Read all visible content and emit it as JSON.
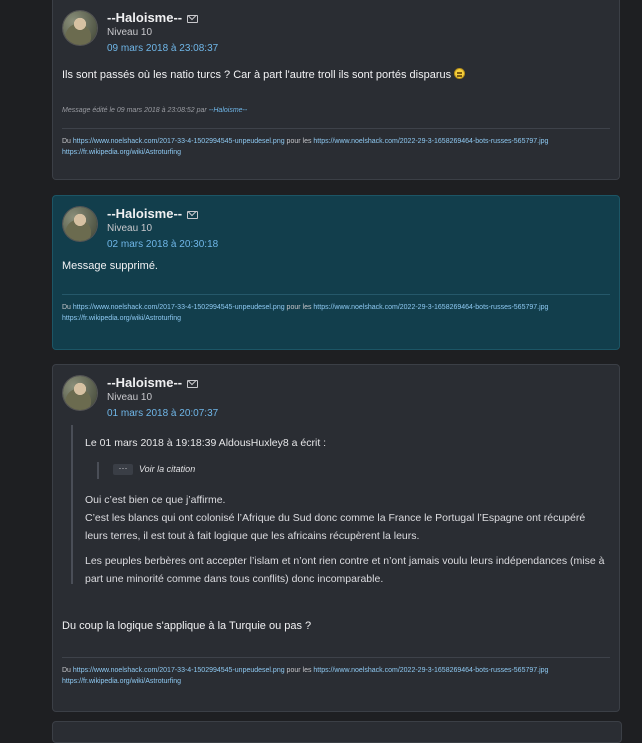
{
  "posts": [
    {
      "author": "--Haloisme--",
      "level": "Niveau 10",
      "date": "09 mars 2018 à 23:08:37",
      "message": "Ils sont passés où les natio turcs ? Car à part l'autre troll ils sont portés disparus",
      "edit_prefix": "Message édité le 09 mars 2018 à 23:08:52 par ",
      "edit_author": "--Haloisme--"
    },
    {
      "author": "--Haloisme--",
      "level": "Niveau 10",
      "date": "02 mars 2018 à 20:30:18",
      "message": "Message supprimé."
    },
    {
      "author": "--Haloisme--",
      "level": "Niveau 10",
      "date": "01 mars 2018 à 20:07:37",
      "quote": {
        "header": "Le 01 mars 2018 à 19:18:39 AldousHuxley8 a écrit :",
        "see_quote_button": "···",
        "see_quote_label": "Voir la citation",
        "para1": "Oui c’est bien ce que j’affirme.\nC’est les blancs qui ont colonisé l’Afrique du Sud donc comme la France le Portugal l’Espagne ont récupéré leurs terres, il est tout à fait logique que les africains récupèrent la leurs.",
        "para2": "Les peuples berbères ont accepter l’islam et n’ont rien contre et n’ont jamais voulu leurs indépendances (mise à part une minorité comme dans tous conflits) donc incomparable."
      },
      "message": "Du coup la logique s'applique à la Turquie ou pas ?"
    }
  ],
  "signature": {
    "du": "Du ",
    "link1": "https://www.noelshack.com/2017-33-4-1502994545-unpeudesel.png",
    "pour_les": " pour les ",
    "link2": "https://www.noelshack.com/2022-29-3-1658269464-bots-russes-565797.jpg",
    "link3": "https://fr.wikipedia.org/wiki/Astroturfing"
  },
  "colors": {
    "page_bg": "#1e1f22",
    "card_bg": "#2a2d33",
    "highlight_bg": "#123e4c",
    "link": "#6fb6e8"
  },
  "icons": [
    "avatar",
    "mail-icon",
    "smiley-emoji",
    "ellipsis-button"
  ]
}
